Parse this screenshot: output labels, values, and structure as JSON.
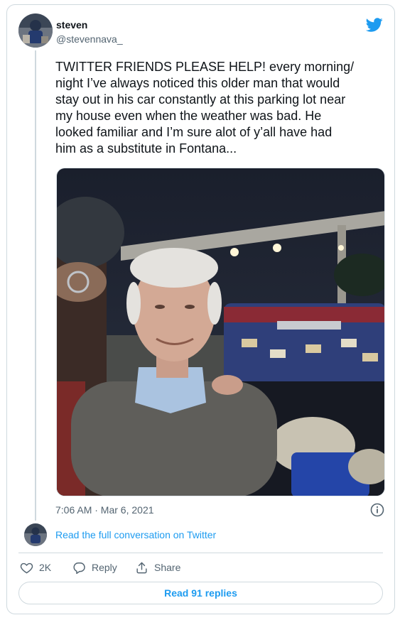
{
  "author": {
    "name": "steven",
    "handle": "@stevennava_"
  },
  "tweet": {
    "text": "TWITTER FRIENDS PLEASE HELP! every morning/\nnight I’ve always noticed this older man that would\nstay out in his car constantly at this parking lot near\nmy house even when the weather was bad. He\nlooked familiar and I’m sure alot of y’all have had\nhim as a substitute in Fontana...",
    "timestamp": "7:06 AM · Mar 6, 2021"
  },
  "conversation": {
    "link_label": "Read the full conversation on Twitter"
  },
  "actions": {
    "like_count": "2K",
    "reply_label": "Reply",
    "share_label": "Share"
  },
  "replies_button": {
    "label": "Read 91 replies"
  },
  "icons": {
    "brand": "twitter-bird-icon",
    "info": "info-icon",
    "like": "heart-icon",
    "reply": "reply-bubble-icon",
    "share": "share-icon"
  },
  "colors": {
    "accent": "#1d9bf0",
    "text": "#0f1419",
    "muted": "#536471",
    "border": "#cfd9de"
  }
}
